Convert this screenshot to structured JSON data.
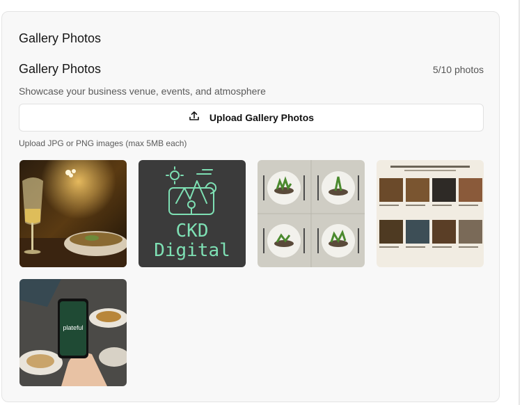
{
  "gallery": {
    "section_title": "Gallery Photos",
    "title": "Gallery Photos",
    "count_text": "5/10 photos",
    "description": "Showcase your business venue, events, and atmosphere",
    "upload_label": "Upload Gallery Photos",
    "upload_icon": "upload-icon",
    "hint": "Upload JPG or PNG images (max 5MB each)",
    "photos": [
      {
        "subject": "restaurant-table-with-wine-glass"
      },
      {
        "subject": "ckd-digital-logo",
        "logo_line1": "CKD",
        "logo_line2": "Digital"
      },
      {
        "subject": "plates-with-food"
      },
      {
        "subject": "restaurant-collage"
      },
      {
        "subject": "phone-with-app",
        "app_text": "plateful"
      }
    ]
  },
  "colors": {
    "card_bg": "#f8f8f8",
    "logo_bg": "#3b3b3b",
    "logo_fg": "#7ee0b4"
  }
}
